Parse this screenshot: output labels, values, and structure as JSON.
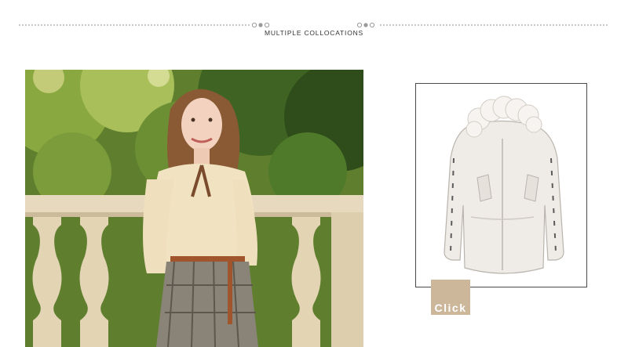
{
  "section": {
    "title": "MULTIPLE COLLOCATIONS"
  },
  "model_photo": {
    "icon": "model-photo"
  },
  "product": {
    "icon": "white-parka-jacket-icon"
  },
  "click_button": {
    "label": "Click",
    "color": "#cdb79b"
  },
  "colors": {
    "accent": "#cdb79b",
    "divider": "#c9c9c9",
    "text": "#333333",
    "card_border": "#4a4a4a"
  }
}
